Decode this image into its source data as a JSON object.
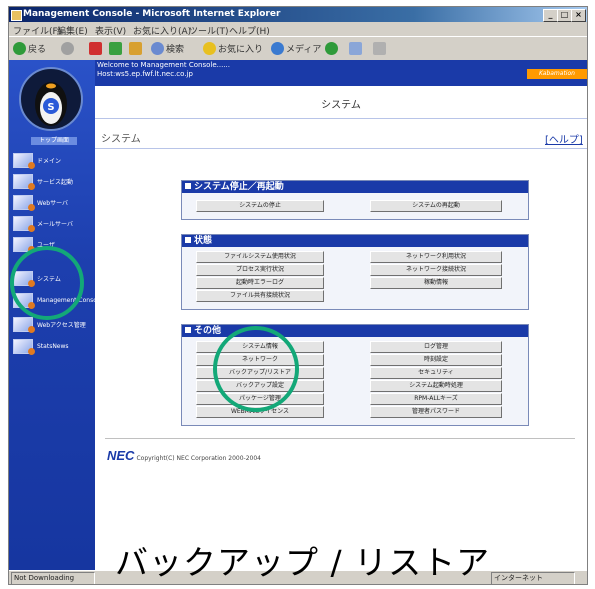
{
  "window": {
    "title": "Management Console - Microsoft Internet Explorer",
    "min_label": "_",
    "max_label": "□",
    "close_label": "×"
  },
  "menu": [
    "ファイル(F)",
    "編集(E)",
    "表示(V)",
    "お気に入り(A)",
    "ツール(T)",
    "ヘルプ(H)"
  ],
  "toolbar": {
    "back": "戻る",
    "search": "検索",
    "favorites": "お気に入り",
    "media": "メディア"
  },
  "sidebar": {
    "home": "トップ画面",
    "items": [
      {
        "label": "ドメイン"
      },
      {
        "label": "サービス起動"
      },
      {
        "label": "Webサーバ"
      },
      {
        "label": "メールサーバ"
      },
      {
        "label": "ユーザ"
      },
      {
        "label": "システム"
      },
      {
        "label": "Management Console"
      },
      {
        "label": "Webアクセス管理"
      },
      {
        "label": "StatsNews"
      }
    ]
  },
  "header": {
    "welcome": "Welcome to Management Console......",
    "host": "Host:ws5.ep.fwf.lt.nec.co.jp",
    "tag": "Kabamation"
  },
  "page": {
    "title": "システム",
    "crumb": "システム",
    "help": "[ヘルプ]"
  },
  "sections": {
    "restart": {
      "title": "システム停止／再起動",
      "buttons": [
        "システムの停止",
        "システムの再起動"
      ]
    },
    "status": {
      "title": "状態",
      "buttons": [
        "ファイルシステム使用状況",
        "プロセス実行状況",
        "起動時エラーログ",
        "ファイル共有接続状況",
        "ネットワーク利用状況",
        "ネットワーク接続状況",
        "稼動情報"
      ]
    },
    "other": {
      "title": "その他",
      "buttons": [
        "システム情報",
        "ネットワーク",
        "バックアップ/リストア",
        "バックアップ設定",
        "パッケージ管理",
        "WEBMAILライセンス",
        "ログ管理",
        "時刻設定",
        "セキュリティ",
        "システム起動時処理",
        "RPM-ALLキーズ",
        "管理者パスワード"
      ]
    }
  },
  "footer": {
    "logo": "NEC",
    "copyright": "Copyright(C) NEC Corporation 2000-2004"
  },
  "status": {
    "left": "Not Downloading",
    "right": "インターネット"
  },
  "caption": "バックアップ / リストア",
  "ring_color": "#13a878"
}
